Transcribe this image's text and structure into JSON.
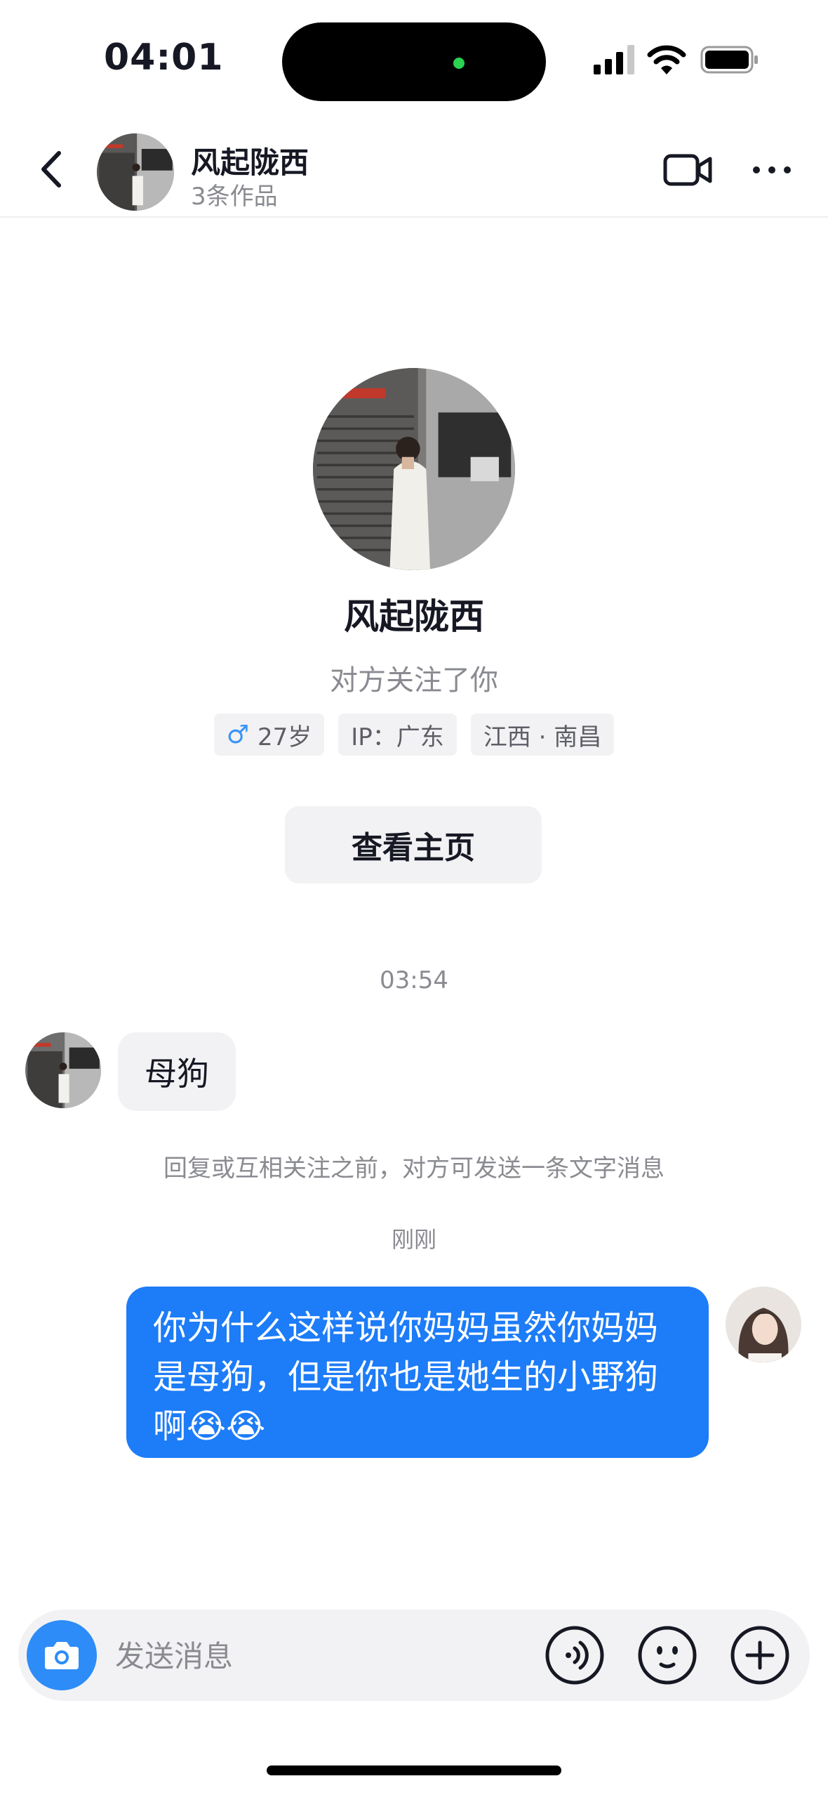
{
  "status_bar": {
    "time": "04:01"
  },
  "header": {
    "name": "风起陇西",
    "subtitle": "3条作品",
    "icons": [
      "back-arrow-icon",
      "video-call-icon",
      "more-icon"
    ]
  },
  "profile": {
    "name": "风起陇西",
    "follow_status": "对方关注了你",
    "gender_symbol": "♂",
    "age": "27岁",
    "ip": "IP：广东",
    "location": "江西 · 南昌",
    "view_home_label": "查看主页"
  },
  "conversation": {
    "timestamp_1": "03:54",
    "incoming_message": "母狗",
    "notice": "回复或互相关注之前，对方可发送一条文字消息",
    "timestamp_2": "刚刚",
    "outgoing_message": "你为什么这样说你妈妈虽然你妈妈是母狗，但是你也是她生的小野狗啊😭😭"
  },
  "input_bar": {
    "placeholder": "发送消息",
    "icons": [
      "camera-icon",
      "voice-icon",
      "emoji-icon",
      "plus-icon"
    ]
  },
  "colors": {
    "accent": "#1d7cf7",
    "camera": "#2d8cf7",
    "bubble_gray": "#f2f2f4",
    "muted_text": "#8a8b91"
  }
}
